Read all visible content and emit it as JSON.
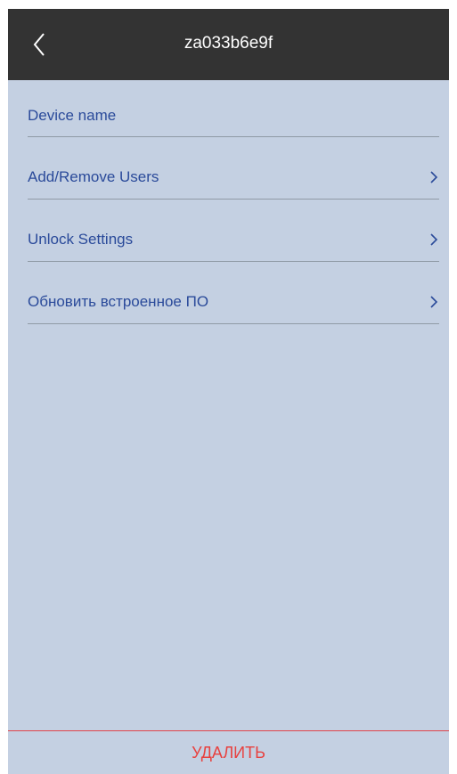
{
  "header": {
    "title": "za033b6e9f",
    "back_icon": "chevron-left-icon"
  },
  "settings": {
    "items": [
      {
        "label": "Device name",
        "has_chevron": false
      },
      {
        "label": "Add/Remove Users",
        "has_chevron": true
      },
      {
        "label": "Unlock Settings",
        "has_chevron": true
      },
      {
        "label": "Обновить встроенное ПО",
        "has_chevron": true
      }
    ],
    "chevron_icon": "chevron-right-icon"
  },
  "footer": {
    "delete_label": "УДАЛИТЬ"
  },
  "colors": {
    "header_bg": "#333333",
    "screen_bg": "#c4d0e2",
    "link_text": "#2a4a9a",
    "danger": "#e8413f"
  }
}
